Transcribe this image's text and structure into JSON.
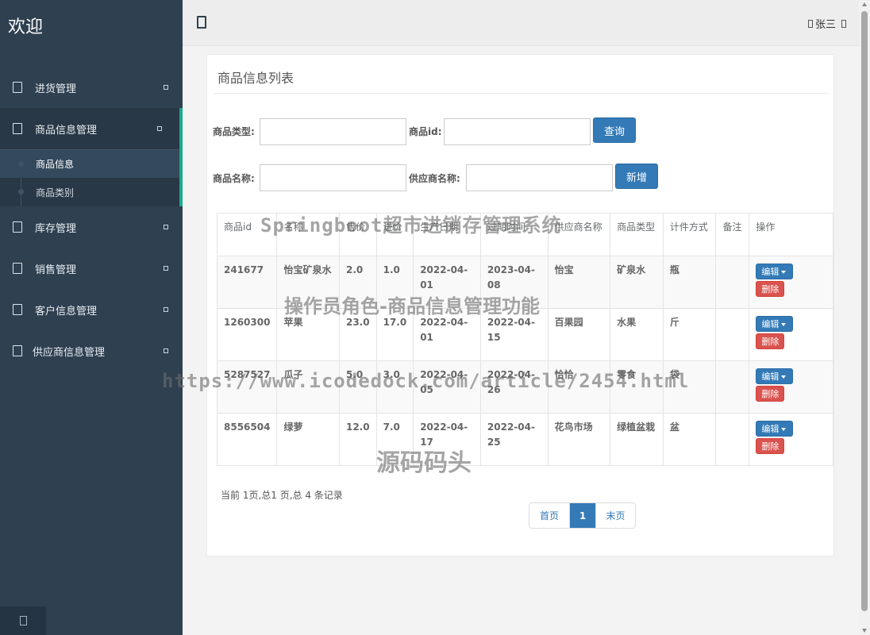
{
  "sidebar": {
    "brand": "欢迎",
    "menu": [
      {
        "label": "进货管理"
      },
      {
        "label": "商品信息管理",
        "active": true,
        "children": [
          {
            "label": "商品信息",
            "current": true
          },
          {
            "label": "商品类别"
          }
        ]
      },
      {
        "label": "库存管理"
      },
      {
        "label": "销售管理"
      },
      {
        "label": "客户信息管理"
      },
      {
        "label": "供应商信息管理"
      }
    ]
  },
  "topbar": {
    "user": "张三",
    "toggle_icon": "menu-toggle-icon"
  },
  "panel": {
    "title": "商品信息列表"
  },
  "search": {
    "type_label": "商品类型:",
    "id_label": "商品id:",
    "name_label": "商品名称:",
    "supplier_label": "供应商名称:",
    "type_value": "",
    "id_value": "",
    "name_value": "",
    "supplier_value": "",
    "query_button": "查询",
    "add_button": "新增"
  },
  "table": {
    "headers": [
      "商品id",
      "名称",
      "售价",
      "进价",
      "生产日期",
      "过期时间",
      "供应商名称",
      "商品类型",
      "计件方式",
      "备注",
      "操作"
    ],
    "rows": [
      {
        "id": "241677",
        "name": "怡宝矿泉水",
        "price": "2.0",
        "cost": "1.0",
        "produced": "2022-04-01",
        "expires": "2023-04-08",
        "supplier": "怡宝",
        "type": "矿泉水",
        "unit": "瓶",
        "note": ""
      },
      {
        "id": "1260300",
        "name": "苹果",
        "price": "23.0",
        "cost": "17.0",
        "produced": "2022-04-01",
        "expires": "2022-04-15",
        "supplier": "百果园",
        "type": "水果",
        "unit": "斤",
        "note": ""
      },
      {
        "id": "5287527",
        "name": "瓜子",
        "price": "5.0",
        "cost": "3.0",
        "produced": "2022-04-05",
        "expires": "2022-04-26",
        "supplier": "恰恰",
        "type": "零食",
        "unit": "袋",
        "note": ""
      },
      {
        "id": "8556504",
        "name": "绿萝",
        "price": "12.0",
        "cost": "7.0",
        "produced": "2022-04-17",
        "expires": "2022-04-25",
        "supplier": "花鸟市场",
        "type": "绿植盆栽",
        "unit": "盆",
        "note": ""
      }
    ],
    "edit_label": "编辑",
    "delete_label": "删除"
  },
  "pagination": {
    "info": "当前 1页,总1 页,总 4 条记录",
    "first": "首页",
    "current": "1",
    "last": "末页"
  },
  "watermarks": {
    "title": "Springboot超市进销存管理系统",
    "subtitle": "操作员角色-商品信息管理功能",
    "url": "https://www.icodedock.com/article/2454.html",
    "brand": "源码码头"
  },
  "colors": {
    "sidebar_bg": "#2f4050",
    "accent": "#19aa8d",
    "primary": "#337ab7",
    "danger": "#d9534f"
  }
}
